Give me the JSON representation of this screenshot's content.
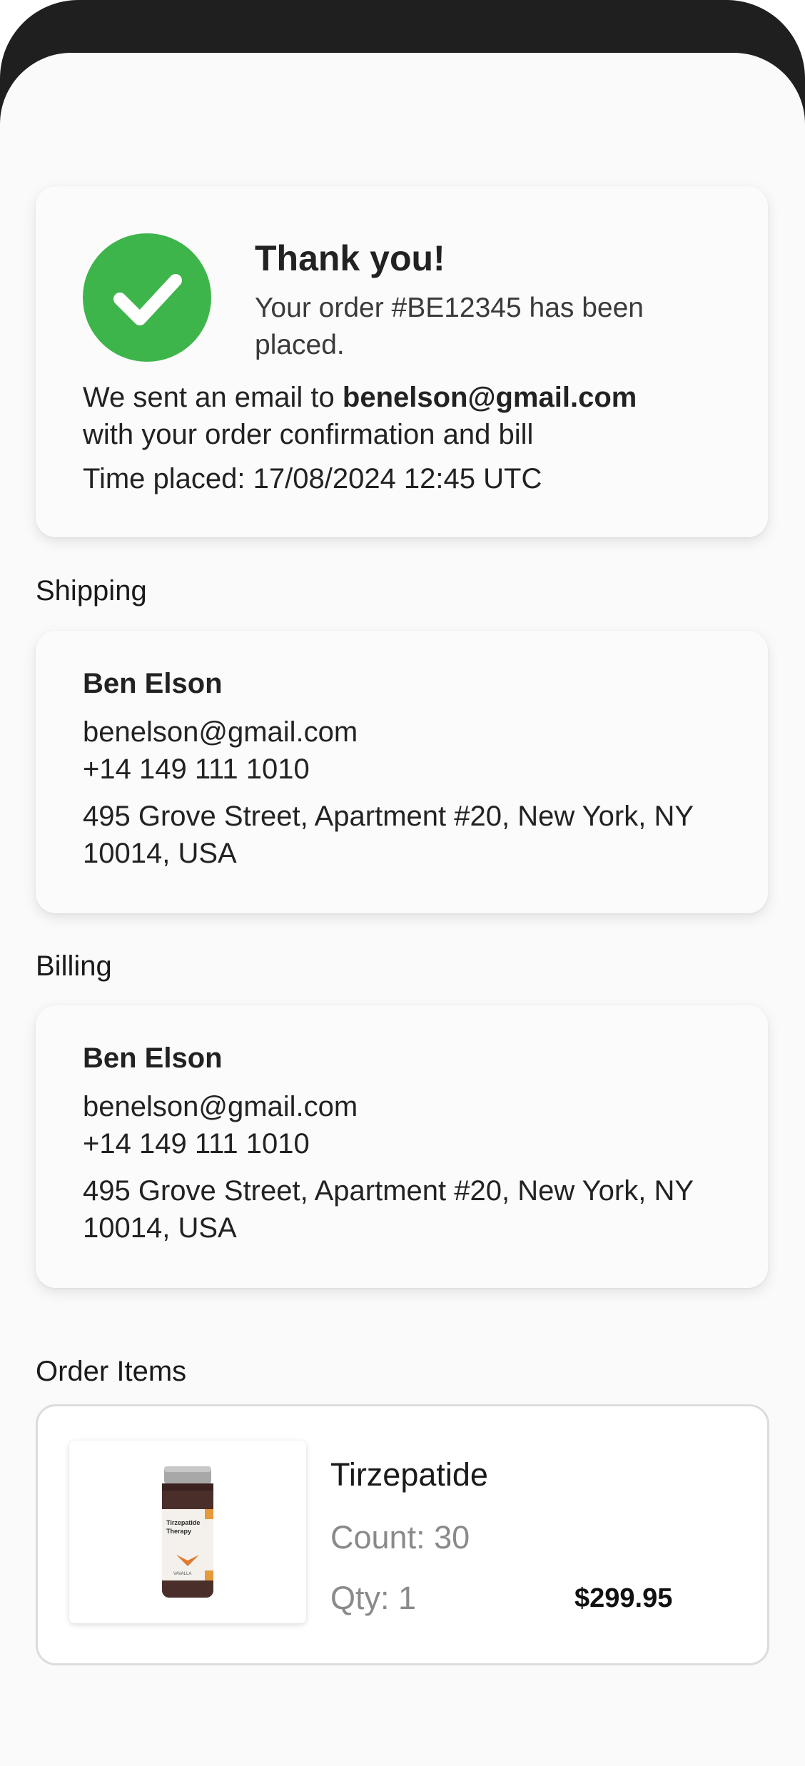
{
  "confirmation": {
    "title": "Thank you!",
    "subtitle": "Your order #BE12345 has been placed.",
    "email_prefix": "We sent an email to ",
    "email": "benelson@gmail.com",
    "email_suffix": "with your order confirmation and bill",
    "time_placed": "Time placed: 17/08/2024 12:45 UTC",
    "icon": "check-circle-icon",
    "accent_color": "#3db54a"
  },
  "shipping": {
    "label": "Shipping",
    "name": "Ben Elson",
    "email": "benelson@gmail.com",
    "phone": "+14 149 111 1010",
    "address": "495 Grove Street, Apartment #20, New York, NY 10014, USA"
  },
  "billing": {
    "label": "Billing",
    "name": "Ben Elson",
    "email": "benelson@gmail.com",
    "phone": "+14 149 111 1010",
    "address": "495 Grove Street, Apartment #20, New York, NY 10014, USA"
  },
  "order_items": {
    "label": "Order Items",
    "items": [
      {
        "name": "Tirzepatide",
        "count": "Count: 30",
        "qty": "Qty: 1",
        "price": "$299.95",
        "image_label_line1": "Tirzepatide",
        "image_label_line2": "Therapy",
        "image_brand": "VAVALLA"
      }
    ]
  }
}
